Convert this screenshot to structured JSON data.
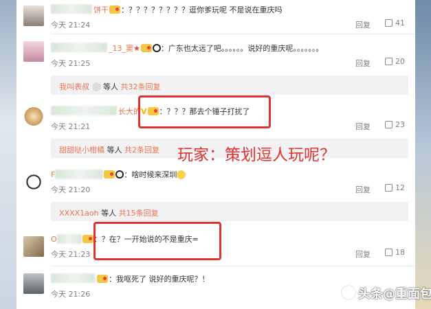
{
  "comments": [
    {
      "name_suffix": "饼干",
      "text": "：？？？？？？？？逗你爹玩呢 不是说在重庆吗",
      "time": "今天 21:24",
      "reply": "回复",
      "likes": "41"
    },
    {
      "name_suffix": "_13_窦",
      "text": "：广东也太远了吧。。。。。。说好的重庆呢。。。。。。。",
      "time": "今天 21:25",
      "reply": "回复",
      "likes": "20"
    },
    {
      "name_suffix": "长大的",
      "text": "：？？？那去个锤子打扰了",
      "time": "今天 21:21",
      "reply": "回复",
      "likes": "23"
    },
    {
      "name_suffix": "F",
      "text": "：啥时候来深圳",
      "time": "今天 21:20",
      "reply": "回复",
      "likes": "12"
    },
    {
      "name_suffix": "O",
      "text": "：？在？一开始说的不是重庆=",
      "time": "今天 21:23",
      "reply": "回复",
      "likes": "18"
    },
    {
      "name_suffix": "",
      "text": "：我呕死了 说好的重庆呢？！",
      "time": "今天 21:26",
      "reply": "",
      "likes": ""
    }
  ],
  "replies": [
    {
      "who": "我叫表叔",
      "mid": "等人",
      "more": "共32条回复"
    },
    {
      "who": "甜甜哒小柑橘",
      "mid": "等人",
      "more": "共2条回复"
    },
    {
      "who": "XXXX1aoh",
      "mid": "等人",
      "more": "共15条回复"
    }
  ],
  "overlay_text": "玩家：策划逗人玩呢？",
  "watermark": "头条@重面包香",
  "colors": {
    "highlight_box": "#e2322f",
    "username": "#eb7350"
  }
}
